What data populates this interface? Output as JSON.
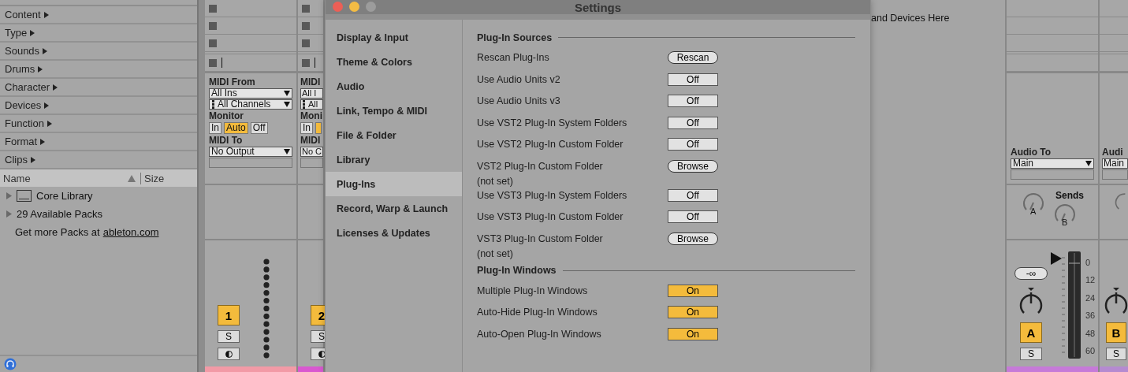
{
  "browser": {
    "categories": [
      "Content",
      "Type",
      "Sounds",
      "Drums",
      "Character",
      "Devices",
      "Function",
      "Format",
      "Clips"
    ],
    "columns": [
      "Name",
      "Size"
    ],
    "items": [
      {
        "label": "Core Library",
        "kind": "library"
      },
      {
        "label": "29 Available Packs",
        "kind": "folder"
      }
    ],
    "footer_text": "Get more Packs at",
    "footer_link": "ableton.com"
  },
  "tracks": [
    {
      "midi_from_label": "MIDI From",
      "input": "All Ins",
      "channel": "All Channels",
      "monitor_label": "Monitor",
      "monitor": [
        {
          "label": "In",
          "selected": false
        },
        {
          "label": "Auto",
          "selected": true
        },
        {
          "label": "Off",
          "selected": false
        }
      ],
      "midi_to_label": "MIDI To",
      "output": "No Output",
      "number": "1",
      "solo": "S",
      "color": "#f29aa6"
    },
    {
      "midi_from_label": "MIDI",
      "input": "All I",
      "channel": "All",
      "monitor_label": "Moni",
      "monitor": [
        {
          "label": "In",
          "selected": false
        },
        {
          "selected": true
        }
      ],
      "midi_to_label": "MIDI",
      "output": "No C",
      "number": "2",
      "solo": "S",
      "color": "#d958d0"
    }
  ],
  "settings": {
    "title": "Settings",
    "tabs": [
      {
        "label": "Display & Input",
        "selected": false
      },
      {
        "label": "Theme & Colors",
        "selected": false
      },
      {
        "label": "Audio",
        "selected": false
      },
      {
        "label": "Link, Tempo & MIDI",
        "selected": false
      },
      {
        "label": "File & Folder",
        "selected": false
      },
      {
        "label": "Library",
        "selected": false
      },
      {
        "label": "Plug-Ins",
        "selected": true
      },
      {
        "label": "Record, Warp & Launch",
        "selected": false
      },
      {
        "label": "Licenses & Updates",
        "selected": false
      }
    ],
    "sections": [
      {
        "title": "Plug-In Sources",
        "rows": [
          {
            "label": "Rescan Plug-Ins",
            "kind": "action",
            "value": "Rescan"
          },
          {
            "label": "Use Audio Units v2",
            "kind": "toggle",
            "value": "Off",
            "on": false
          },
          {
            "label": "Use Audio Units v3",
            "kind": "toggle",
            "value": "Off",
            "on": false
          },
          {
            "label": "Use VST2 Plug-In System Folders",
            "kind": "toggle",
            "value": "Off",
            "on": false
          },
          {
            "label": "Use VST2 Plug-In Custom Folder",
            "kind": "toggle",
            "value": "Off",
            "on": false
          },
          {
            "label": "VST2 Plug-In Custom Folder",
            "note": "(not set)",
            "kind": "action",
            "value": "Browse"
          },
          {
            "label": "Use VST3 Plug-In System Folders",
            "kind": "toggle",
            "value": "Off",
            "on": false
          },
          {
            "label": "Use VST3 Plug-In Custom Folder",
            "kind": "toggle",
            "value": "Off",
            "on": false
          },
          {
            "label": "VST3 Plug-In Custom Folder",
            "note": "(not set)",
            "kind": "action",
            "value": "Browse"
          }
        ]
      },
      {
        "title": "Plug-In Windows",
        "rows": [
          {
            "label": "Multiple Plug-In Windows",
            "kind": "toggle",
            "value": "On",
            "on": true
          },
          {
            "label": "Auto-Hide Plug-In Windows",
            "kind": "toggle",
            "value": "On",
            "on": true
          },
          {
            "label": "Auto-Open Plug-In Windows",
            "kind": "toggle",
            "value": "On",
            "on": true
          }
        ]
      }
    ]
  },
  "arrangement_hint": "and Devices Here",
  "returns": [
    {
      "audio_to_label": "Audio To",
      "output": "Main",
      "sends_label": "Sends",
      "sends": [
        "A",
        "B"
      ],
      "volume": "-∞",
      "letter": "A",
      "solo": "S",
      "meter_ticks": [
        "0",
        "12",
        "24",
        "36",
        "48",
        "60"
      ],
      "color": "#c67ad8"
    },
    {
      "audio_to_label": "Audi",
      "output": "Main",
      "letter": "B",
      "solo": "S",
      "color": "#b58ad0"
    }
  ]
}
